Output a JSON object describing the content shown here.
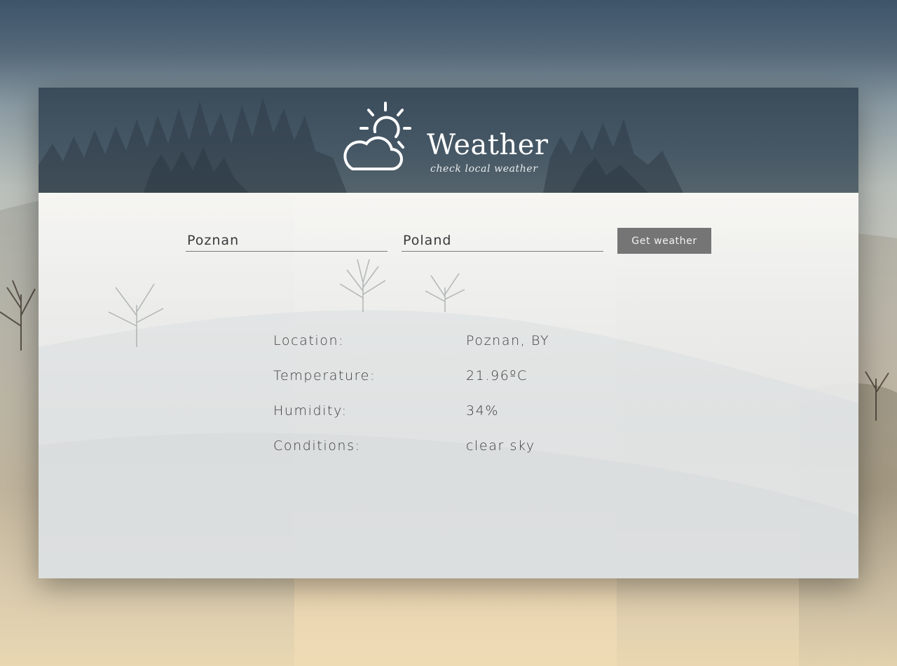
{
  "header": {
    "title": "Weather",
    "subtitle": "check local weather",
    "logo_icon": "sun-behind-cloud-icon"
  },
  "form": {
    "city_value": "Poznan",
    "country_value": "Poland",
    "submit_label": "Get weather"
  },
  "results": [
    {
      "label": "Location:",
      "value": "Poznan, BY"
    },
    {
      "label": "Temperature:",
      "value": "21.96ºC"
    },
    {
      "label": "Humidity:",
      "value": "34%"
    },
    {
      "label": "Conditions:",
      "value": "clear sky"
    }
  ],
  "colors": {
    "button_bg": "#757575",
    "header_bg": "#3a4b5a",
    "text": "#3c3c3c"
  }
}
